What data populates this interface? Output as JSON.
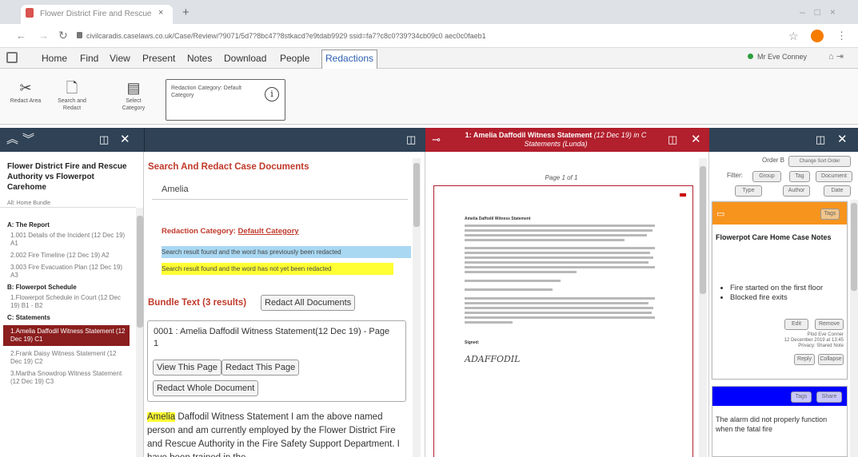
{
  "browser": {
    "tab_title": "Flower District Fire and Rescue",
    "url": "civilcaradis.caselaws.co.uk/Case/Review/?9071/5d7?8bc47?8stkacd?e9tdab9929 ssid=fa7?c8c0?39?34cb09c0 aec0c0faeb1"
  },
  "menu": {
    "items": [
      "Home",
      "Find",
      "View",
      "Present",
      "Notes",
      "Download",
      "People"
    ],
    "active": "Redactions",
    "user": "Mr Eve Conney"
  },
  "ribbon": {
    "buttons": [
      {
        "label": "Redact Area"
      },
      {
        "label": "Search and Redact"
      },
      {
        "label": "Select Category"
      }
    ],
    "category_text": "Redaction Category: Default Category"
  },
  "tree": {
    "title": "Flower District Fire and Rescue Authority vs Flowerpot Carehome",
    "breadcrumb": "All: Home Bundle",
    "sections": [
      {
        "title": "A: The Report",
        "items": [
          "1.001 Details of the Incident (12 Dec 19) A1",
          "2.002 Fire Timeline (12 Dec 19) A2",
          "3.003 Fire Evacuation Plan (12 Dec 19) A3"
        ]
      },
      {
        "title": "B: Flowerpot Schedule",
        "items": [
          "1.Flowerpot Schedule in Court (12 Dec 19) B1 - B2"
        ]
      },
      {
        "title": "C: Statements",
        "items": [
          "1.Amelia Daffodil Witness Statement (12 Dec 19) C1",
          "2.Frank Daisy Witness Statement (12 Dec 19) C2",
          "3.Martha Snowdrop Witness Statement (12 Dec 19) C3"
        ]
      }
    ],
    "selected": "1.Amelia Daffodil Witness Statement (12 Dec 19) C1"
  },
  "search": {
    "heading": "Search And Redact Case Documents",
    "query": "Amelia",
    "category_label": "Redaction Category:",
    "category_value": "Default Category",
    "legend_redacted": "Search result found and the word has previously been redacted",
    "legend_not_redacted": "Search result found and the word has not yet been redacted",
    "bundle_heading": "Bundle Text (3 results)",
    "redact_all": "Redact All Documents",
    "result_title": "0001 : Amelia Daffodil Witness Statement(12 Dec 19) - Page 1",
    "view_page": "View This Page",
    "redact_page": "Redact This Page",
    "redact_doc": "Redact Whole Document",
    "snippet_highlight": "Amelia",
    "snippet_text": " Daffodil Witness Statement I am the above named person and am currently employed by the Flower District Fire and Rescue Authority in the Fire Safety Support Department. I have been trained in the"
  },
  "viewer": {
    "title": "1: Amelia Daffodil Witness Statement",
    "title_sub": "(12 Dec 19) in C Statements (Lunda)",
    "page_label": "Page 1 of 1",
    "doc_heading": "Amelia Daffodil Witness Statement",
    "doc_signed": "Signed:",
    "doc_signature": "ADAFFODIL"
  },
  "notes": {
    "order_label": "Order B",
    "order_btn": "Change Sort Order",
    "filter_label": "Filter:",
    "filter_btns": [
      "Group",
      "Tag",
      "Document",
      "Type",
      "Author",
      "Date"
    ],
    "note1": {
      "tag_btn": "Tags",
      "title": "Flowerpot Care Home Case Notes",
      "bullets": [
        "Fire started on the first floor",
        "Blocked fire exits"
      ],
      "edit": "Edit",
      "remove": "Remove",
      "meta": [
        "Plod Eve Conner",
        "12 December 2019 at 13:45",
        "Privacy: Shared Note"
      ],
      "reply": "Reply",
      "collapse": "Collapse"
    },
    "note2": {
      "tags_btn": "Tags",
      "share_btn": "Share",
      "text": "The alarm did not properly function when the fatal fire"
    }
  },
  "colors": {
    "header": "#2f4256",
    "viewer_header": "#b21f2d",
    "selected_tree": "#8b1e1e",
    "note1_bar": "#f7941d",
    "note2_bar": "#0000ff",
    "hl_blue": "#a9d8f2",
    "hl_yellow": "#ffff33",
    "link_red": "#c0392b"
  }
}
